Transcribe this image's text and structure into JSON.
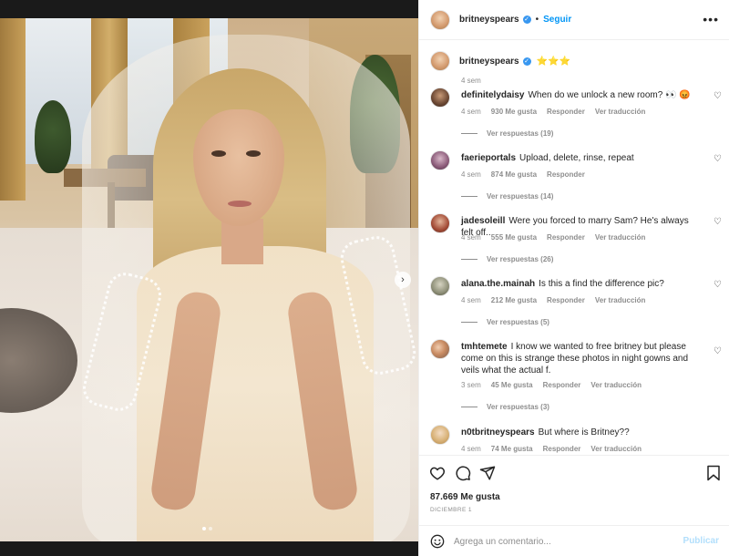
{
  "post": {
    "username": "britneyspears",
    "follow_separator": "•",
    "follow_label": "Seguir",
    "more_label": "•••",
    "caption": "⭐⭐⭐",
    "caption_time": "4 sem",
    "next_label": "›",
    "carousel_count": 2,
    "carousel_active": 1
  },
  "comments": [
    {
      "user": "definitelydaisy",
      "text": "When do we unlock a new room? 👀 😡",
      "time": "4 sem",
      "likes": "930 Me gusta",
      "reply": "Responder",
      "translate": "Ver traducción",
      "replies": "Ver respuestas (19)"
    },
    {
      "user": "faerieportals",
      "text": "Upload, delete, rinse, repeat",
      "time": "4 sem",
      "likes": "874 Me gusta",
      "reply": "Responder",
      "translate": "",
      "replies": "Ver respuestas (14)"
    },
    {
      "user": "jadesoleill",
      "text": "Were you forced to marry Sam? He's always felt off..",
      "time": "4 sem",
      "likes": "555 Me gusta",
      "reply": "Responder",
      "translate": "Ver traducción",
      "replies": "Ver respuestas (26)"
    },
    {
      "user": "alana.the.mainah",
      "text": "Is this a find the difference pic?",
      "time": "4 sem",
      "likes": "212 Me gusta",
      "reply": "Responder",
      "translate": "Ver traducción",
      "replies": "Ver respuestas (5)"
    },
    {
      "user": "tmhtemete",
      "text": "I know we wanted to free britney but please come on this is strange these photos in night gowns and veils what the actual f.",
      "time": "3 sem",
      "likes": "45 Me gusta",
      "reply": "Responder",
      "translate": "Ver traducción",
      "replies": "Ver respuestas (3)"
    },
    {
      "user": "n0tbritneyspears",
      "text": "But where is Britney??",
      "time": "4 sem",
      "likes": "74 Me gusta",
      "reply": "Responder",
      "translate": "Ver traducción",
      "replies": ""
    }
  ],
  "footer": {
    "likes": "87.669 Me gusta",
    "date": "DICIEMBRE 1",
    "comment_placeholder": "Agrega un comentario...",
    "publish_label": "Publicar"
  },
  "colors": {
    "accent": "#0095f6",
    "verified": "#3897f0",
    "publish_disabled": "#b2dffc"
  },
  "icons": [
    "heart-icon",
    "comment-icon",
    "share-icon",
    "bookmark-icon",
    "emoji-icon",
    "verified-badge",
    "more-icon",
    "chevron-right-icon"
  ]
}
